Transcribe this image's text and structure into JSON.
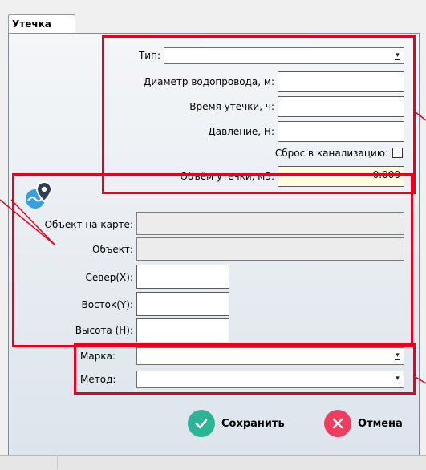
{
  "tab": {
    "label": "Утечка"
  },
  "leak": {
    "type_label": "Тип:",
    "type_value": "",
    "diameter_label": "Диаметр водопровода, м:",
    "diameter_value": "",
    "duration_label": "Время утечки, ч:",
    "duration_value": "",
    "pressure_label": "Давление, Н:",
    "pressure_value": "",
    "sewer_label": "Сброс в канализацию:",
    "sewer_checked": false,
    "volume_label": "Объём утечки, м3:",
    "volume_value": "0.000"
  },
  "location": {
    "icon": "map-location-pin-icon",
    "map_object_label": "Объект на карте:",
    "map_object_value": "",
    "object_label": "Объект:",
    "object_value": "",
    "north_label": "Север(X):",
    "north_value": "",
    "east_label": "Восток(Y):",
    "east_value": "",
    "height_label": "Высота (Н):",
    "height_value": ""
  },
  "equipment": {
    "brand_label": "Марка:",
    "brand_value": "",
    "method_label": "Метод:",
    "method_value": ""
  },
  "actions": {
    "save_label": "Сохранить",
    "cancel_label": "Отмена"
  },
  "colors": {
    "highlight": "#e8001c",
    "save": "#2bb596",
    "cancel": "#ef3d62",
    "volume_field": "#fffde0"
  }
}
